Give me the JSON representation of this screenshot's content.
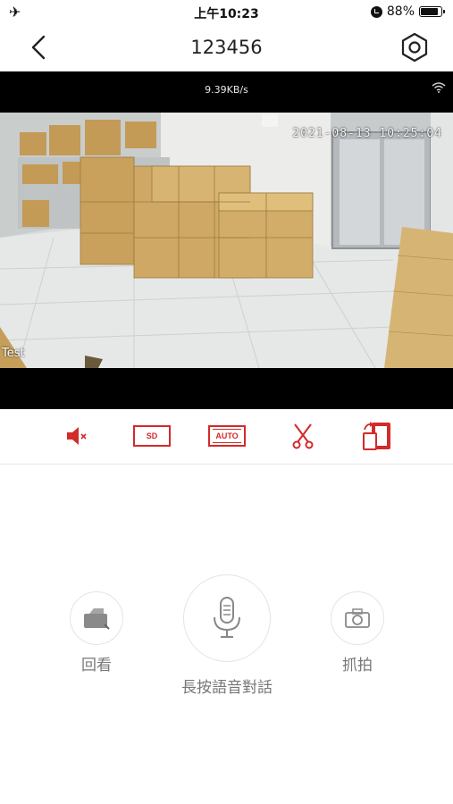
{
  "status_bar": {
    "airplane_icon": "airplane-icon",
    "time": "上午10:23",
    "battery": "88%"
  },
  "nav": {
    "title": "123456",
    "back_icon": "chevron-left-icon",
    "settings_icon": "gear-icon"
  },
  "video": {
    "speed": "9.39KB/s",
    "timestamp": "2021-08-13 10:25:04",
    "camera_label": "Test"
  },
  "toolbar": {
    "items": [
      {
        "name": "mute",
        "icon": "speaker-muted-icon"
      },
      {
        "name": "quality",
        "label": "SD"
      },
      {
        "name": "mode",
        "label": "AUTO"
      },
      {
        "name": "ptz",
        "icon": "scissors-icon"
      },
      {
        "name": "rotate",
        "icon": "rotate-screen-icon"
      }
    ]
  },
  "actions": {
    "playback_label": "回看",
    "talk_label": "長按語音對話",
    "snapshot_label": "抓拍"
  },
  "colors": {
    "accent": "#d32a2a",
    "label_gray": "#777777"
  }
}
